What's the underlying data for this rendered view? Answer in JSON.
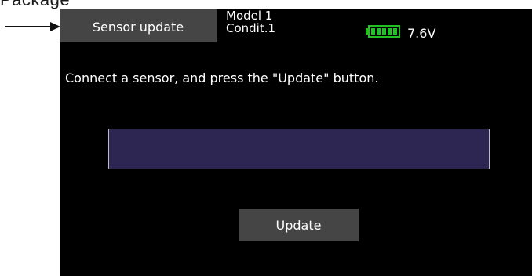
{
  "annotation": {
    "label": "Package"
  },
  "header": {
    "title": "Sensor update",
    "model": "Model 1",
    "condition": "Condit.1",
    "battery_icon": "battery-icon",
    "battery_color": "#22c022",
    "voltage": "7.6V"
  },
  "main": {
    "instruction": "Connect a sensor, and press the \"Update\" button.",
    "progress_color": "#2d2652",
    "update_label": "Update"
  }
}
